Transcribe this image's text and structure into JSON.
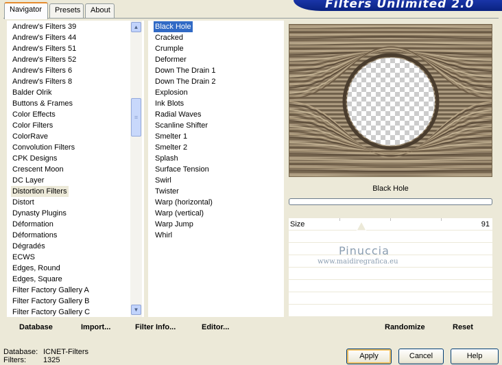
{
  "tabs": [
    "Navigator",
    "Presets",
    "About"
  ],
  "banner": "Filters Unlimited 2.0",
  "categories": [
    "Andrew's Filters 39",
    "Andrew's Filters 44",
    "Andrew's Filters 51",
    "Andrew's Filters 52",
    "Andrew's Filters 6",
    "Andrew's Filters 8",
    "Balder Olrik",
    "Buttons & Frames",
    "Color Effects",
    "Color Filters",
    "ColorRave",
    "Convolution Filters",
    "CPK Designs",
    "Crescent Moon",
    "DC Layer",
    "Distortion Filters",
    "Distort",
    "Dynasty Plugins",
    "Déformation",
    "Déformations",
    "Dégradés",
    "ECWS",
    "Edges, Round",
    "Edges, Square",
    "Filter Factory Gallery A",
    "Filter Factory Gallery B",
    "Filter Factory Gallery C"
  ],
  "selected_category": "Distortion Filters",
  "filters": [
    "Black Hole",
    "Cracked",
    "Crumple",
    "Deformer",
    "Down The Drain 1",
    "Down The Drain 2",
    "Explosion",
    "Ink Blots",
    "Radial Waves",
    "Scanline Shifter",
    "Smelter 1",
    "Smelter 2",
    "Splash",
    "Surface Tension",
    "Swirl",
    "Twister",
    "Warp (horizontal)",
    "Warp (vertical)",
    "Warp Jump",
    "Whirl"
  ],
  "selected_filter": "Black Hole",
  "toolbar": {
    "database": "Database",
    "import": "Import...",
    "filter_info": "Filter Info...",
    "editor": "Editor...",
    "randomize": "Randomize",
    "reset": "Reset"
  },
  "preview": {
    "filter_name": "Black Hole"
  },
  "params": {
    "size_label": "Size",
    "size_value": "91",
    "size_fraction": 0.357
  },
  "watermark": {
    "name": "Pinuccia",
    "url": "www.maidiregrafica.eu"
  },
  "status": {
    "database_label": "Database:",
    "database_value": "ICNET-Filters",
    "filters_label": "Filters:",
    "filters_value": "1325"
  },
  "buttons": {
    "apply": "Apply",
    "cancel": "Cancel",
    "help": "Help"
  },
  "colors": {
    "selection": "#316ac5",
    "dialog_bg": "#ece9d8",
    "banner": "#0a2280"
  }
}
